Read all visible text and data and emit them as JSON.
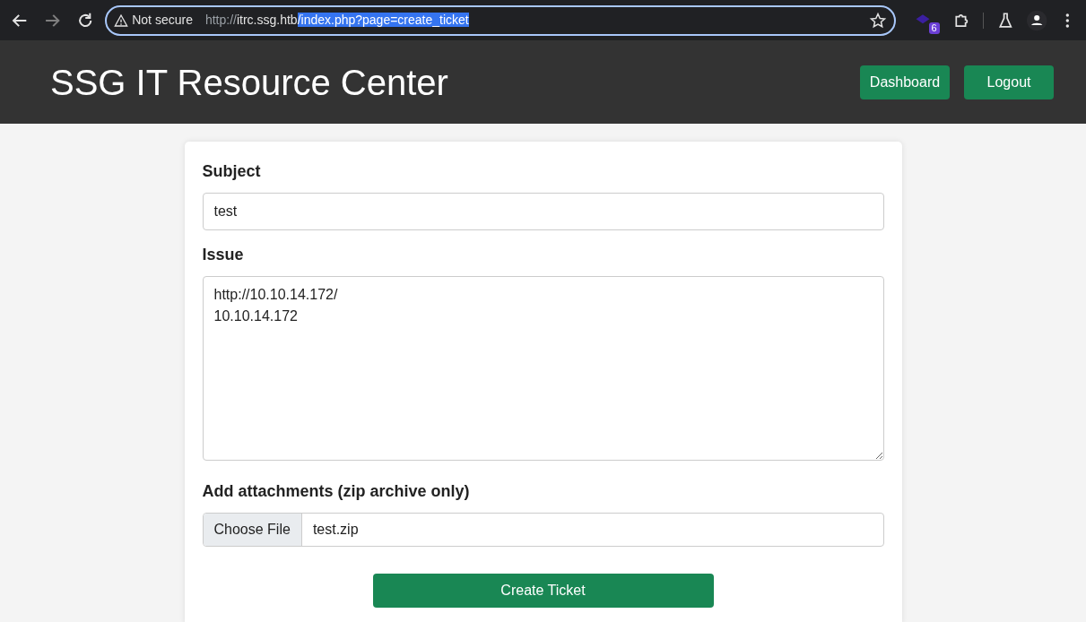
{
  "browser": {
    "security_label": "Not secure",
    "url_parts": [
      {
        "kind": "scheme",
        "text": "http://"
      },
      {
        "kind": "host",
        "text": "itrc.ssg.htb"
      },
      {
        "kind": "selected",
        "text": "/index.php?page=create_ticket"
      }
    ],
    "extension_badge": "6"
  },
  "header": {
    "title": "SSG IT Resource Center",
    "buttons": [
      "Dashboard",
      "Logout"
    ]
  },
  "form": {
    "subject": {
      "label": "Subject",
      "value": "test"
    },
    "issue": {
      "label": "Issue",
      "value": "http://10.10.14.172/\n10.10.14.172"
    },
    "attachment": {
      "label": "Add attachments (zip archive only)",
      "button": "Choose File",
      "file_name": "test.zip"
    },
    "submit": "Create Ticket"
  }
}
